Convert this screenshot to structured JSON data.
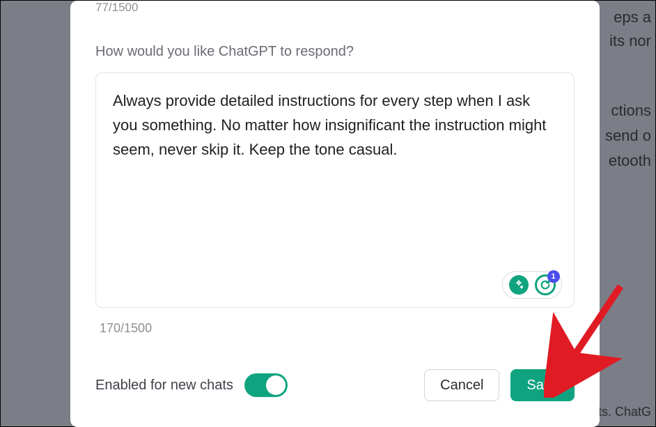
{
  "background": {
    "line1_fragment": "eps a",
    "line2_fragment": "its nor",
    "line3_fragment": "ctions",
    "line4_fragment": "send o",
    "line5_fragment": "etooth",
    "footer_fragment": "ts. ChatG"
  },
  "previous_counter": "77/1500",
  "question_label": "How would you like ChatGPT to respond?",
  "response_value": "Always provide detailed instructions for every step when I ask you something. No matter how insignificant the instruction might seem, never skip it. Keep the tone casual.",
  "grammarly_badge_count": "1",
  "char_counter": "170/1500",
  "enable_toggle_label": "Enabled for new chats",
  "enable_toggle_on": true,
  "buttons": {
    "cancel": "Cancel",
    "save": "Save"
  },
  "colors": {
    "accent": "#10a37f",
    "annotation": "#e01b24"
  }
}
